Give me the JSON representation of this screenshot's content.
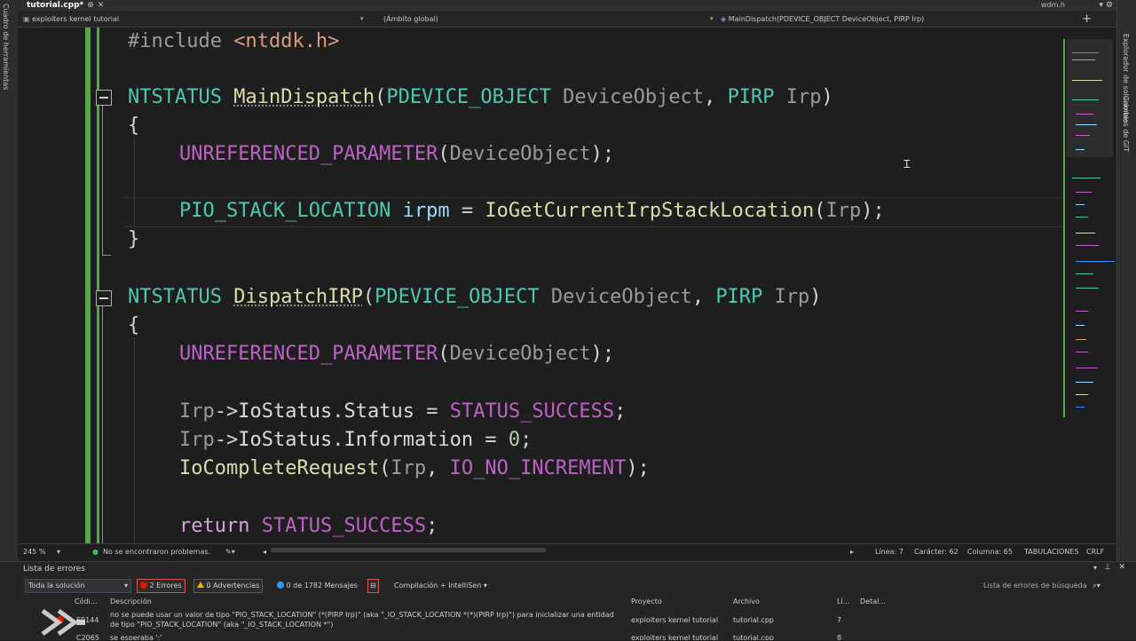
{
  "left_panel": {
    "label": "Cuadro de herramientas"
  },
  "right_panel": {
    "explorer_label": "Explorador de soluciones",
    "git_label": "Cambios de GIT"
  },
  "tabs": {
    "active_label": "tutorial.cpp*",
    "pin_icon": "pin-icon",
    "close_icon": "close-icon",
    "other_label": "wdm.h"
  },
  "navbar": {
    "project": "exploiters kernel tutorial",
    "scope": "(Ámbito global)",
    "member": "MainDispatch(PDEVICE_OBJECT DeviceObject, PIRP Irp)",
    "add_icon": "+"
  },
  "code": {
    "line1": {
      "directive": "#include",
      "header": "<ntddk.h>"
    },
    "f1": {
      "ret": "NTSTATUS",
      "name": "MainDispatch",
      "p1type": "PDEVICE_OBJECT",
      "p1": "DeviceObject",
      "p2type": "PIRP",
      "p2": "Irp"
    },
    "open_brace": "{",
    "close_brace": "}",
    "unref": "UNREFERENCED_PARAMETER",
    "unref_arg": "DeviceObject",
    "stack_type": "PIO_STACK_LOCATION",
    "stack_var": "irpm",
    "stack_fn": "IoGetCurrentIrpStackLocation",
    "stack_arg": "Irp",
    "f2": {
      "ret": "NTSTATUS",
      "name": "DispatchIRP",
      "p1type": "PDEVICE_OBJECT",
      "p1": "DeviceObject",
      "p2type": "PIRP",
      "p2": "Irp"
    },
    "s1": {
      "obj": "Irp",
      "field": "IoStatus",
      "member": "Status",
      "value": "STATUS_SUCCESS"
    },
    "s2": {
      "obj": "Irp",
      "field": "IoStatus",
      "member": "Information",
      "value": "0"
    },
    "s3": {
      "fn": "IoCompleteRequest",
      "a1": "Irp",
      "a2": "IO_NO_INCREMENT"
    },
    "s4": {
      "kw": "return",
      "value": "STATUS_SUCCESS"
    }
  },
  "status": {
    "zoom": "245 %",
    "issues": "No se encontraron problemas.",
    "line": "Línea: 7",
    "char": "Carácter: 62",
    "column": "Columna: 65",
    "tabs": "TABULACIONES",
    "eol": "CRLF"
  },
  "errors": {
    "title": "Lista de errores",
    "scope": "Toda la solución",
    "errors_count": "2 Errores",
    "warnings_count": "0 Advertencias",
    "messages_count": "0 de 1782 Mensajes",
    "build_filter": "Compilación + IntelliSen",
    "search_placeholder": "Lista de errores de búsqueda",
    "columns": [
      "Códi...",
      "Descripción",
      "Proyecto",
      "Archivo",
      "Lí...",
      "Detal..."
    ],
    "rows": [
      {
        "code": "E0144",
        "desc1": "no se puede usar un valor de tipo \"PIO_STACK_LOCATION\" (*(PIRP Irp)\" (aka \"_IO_STACK_LOCATION *(*)(PIRP Irp)\") para inicializar una entidad",
        "desc2": "de tipo \"PIO_STACK_LOCATION\" (aka \"_IO_STACK_LOCATION *\")",
        "project": "exploiters kernel tutorial",
        "file": "tutorial.cpp",
        "line": "7"
      },
      {
        "code": "C2065",
        "desc1": "se esperaba ';'",
        "desc2": "",
        "project": "exploiters kernel tutorial",
        "file": "tutorial.cpp",
        "line": "8"
      }
    ]
  },
  "colors": {
    "accent_green": "#57a64a",
    "error": "#e51400",
    "warning": "#f0b400",
    "info": "#3794ff"
  }
}
